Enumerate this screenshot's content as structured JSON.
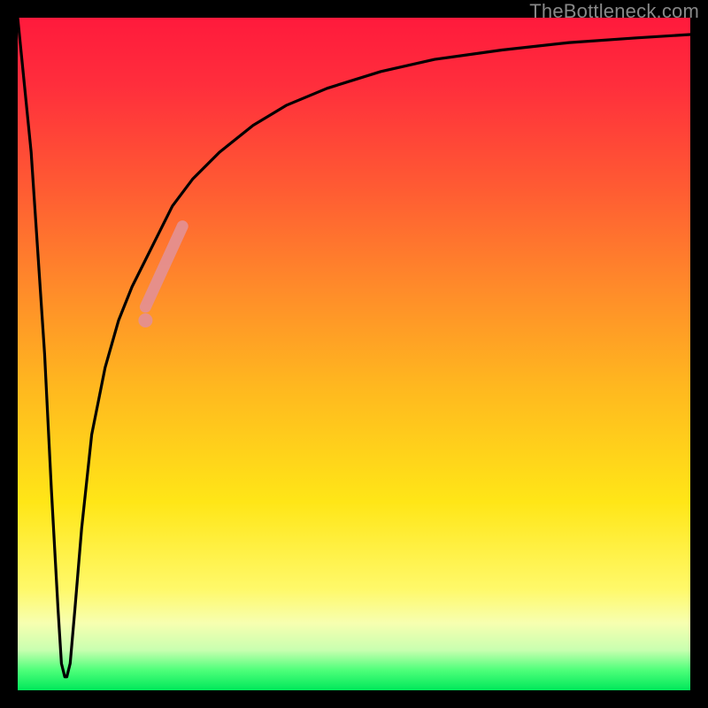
{
  "watermark": "TheBottleneck.com",
  "colors": {
    "gradient_top": "#ff1a3c",
    "gradient_mid": "#ffe617",
    "gradient_bottom": "#00e85a",
    "curve": "#000000",
    "highlight": "#e58f8f"
  },
  "chart_data": {
    "type": "line",
    "title": "",
    "xlabel": "",
    "ylabel": "",
    "xlim": [
      0,
      100
    ],
    "ylim": [
      0,
      100
    ],
    "grid": false,
    "series": [
      {
        "name": "bottleneck-curve",
        "x": [
          0,
          2,
          4,
          5,
          6,
          6.5,
          7,
          7.3,
          7.8,
          8.5,
          9.5,
          11,
          13,
          15,
          17,
          19,
          21,
          23,
          26,
          30,
          35,
          40,
          46,
          54,
          62,
          72,
          82,
          92,
          100
        ],
        "y": [
          100,
          80,
          50,
          30,
          12,
          4,
          2,
          2,
          4,
          12,
          24,
          38,
          48,
          55,
          60,
          64,
          68,
          72,
          76,
          80,
          84,
          87,
          89.5,
          92,
          93.8,
          95.2,
          96.3,
          97,
          97.5
        ]
      }
    ],
    "annotations": [
      {
        "name": "highlight-segment",
        "type": "line-segment",
        "x": [
          19,
          24.5
        ],
        "y": [
          57,
          69
        ]
      },
      {
        "name": "highlight-dot",
        "type": "point",
        "x": 19,
        "y": 55
      }
    ]
  }
}
